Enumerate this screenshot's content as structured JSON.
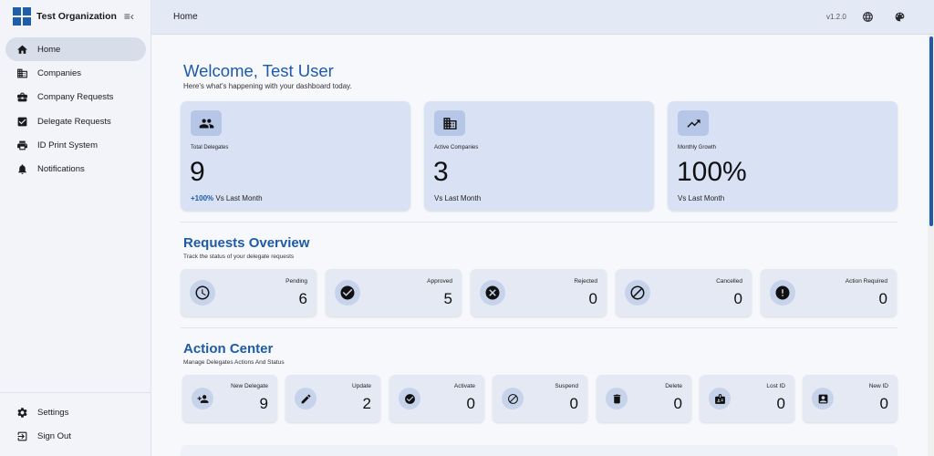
{
  "brand": {
    "name": "Test Organization"
  },
  "sidebar": {
    "items": [
      {
        "label": "Home",
        "icon": "home-icon",
        "active": true
      },
      {
        "label": "Companies",
        "icon": "building-icon",
        "active": false
      },
      {
        "label": "Company Requests",
        "icon": "briefcase-icon",
        "active": false
      },
      {
        "label": "Delegate Requests",
        "icon": "checkbox-icon",
        "active": false
      },
      {
        "label": "ID Print System",
        "icon": "printer-icon",
        "active": false
      },
      {
        "label": "Notifications",
        "icon": "bell-icon",
        "active": false
      }
    ],
    "bottom": [
      {
        "label": "Settings",
        "icon": "gear-icon"
      },
      {
        "label": "Sign Out",
        "icon": "logout-icon"
      }
    ]
  },
  "topbar": {
    "breadcrumb": "Home",
    "version": "v1.2.0"
  },
  "welcome": {
    "title": "Welcome, Test User",
    "subtitle": "Here's what's happening with your dashboard today."
  },
  "stats": [
    {
      "label": "Total Delegates",
      "value": "9",
      "trend_pct": "+100%",
      "trend_text": "Vs Last Month",
      "icon": "group-icon"
    },
    {
      "label": "Active Companies",
      "value": "3",
      "trend_pct": "",
      "trend_text": "Vs Last Month",
      "icon": "building-icon"
    },
    {
      "label": "Monthly Growth",
      "value": "100%",
      "trend_pct": "",
      "trend_text": "Vs Last Month",
      "icon": "trending-up-icon"
    }
  ],
  "requests": {
    "title": "Requests Overview",
    "subtitle": "Track the status of your delegate requests",
    "items": [
      {
        "label": "Pending",
        "value": "6",
        "icon": "clock-icon"
      },
      {
        "label": "Approved",
        "value": "5",
        "icon": "check-circle-icon"
      },
      {
        "label": "Rejected",
        "value": "0",
        "icon": "x-circle-icon"
      },
      {
        "label": "Cancelled",
        "value": "0",
        "icon": "block-icon"
      },
      {
        "label": "Action Required",
        "value": "0",
        "icon": "alert-icon"
      }
    ]
  },
  "actions": {
    "title": "Action Center",
    "subtitle": "Manage Delegates Actions And Status",
    "items": [
      {
        "label": "New Delegate",
        "value": "9",
        "icon": "person-add-icon"
      },
      {
        "label": "Update",
        "value": "2",
        "icon": "pencil-icon"
      },
      {
        "label": "Activate",
        "value": "0",
        "icon": "check-circle-icon"
      },
      {
        "label": "Suspend",
        "value": "0",
        "icon": "block-icon"
      },
      {
        "label": "Delete",
        "value": "0",
        "icon": "trash-icon"
      },
      {
        "label": "Lost ID",
        "value": "0",
        "icon": "badge-icon"
      },
      {
        "label": "New ID",
        "value": "0",
        "icon": "id-card-icon"
      }
    ]
  },
  "colors": {
    "accent": "#1e5aa8",
    "card": "#d9e2f5",
    "sidebar_active": "#d7dde9"
  }
}
